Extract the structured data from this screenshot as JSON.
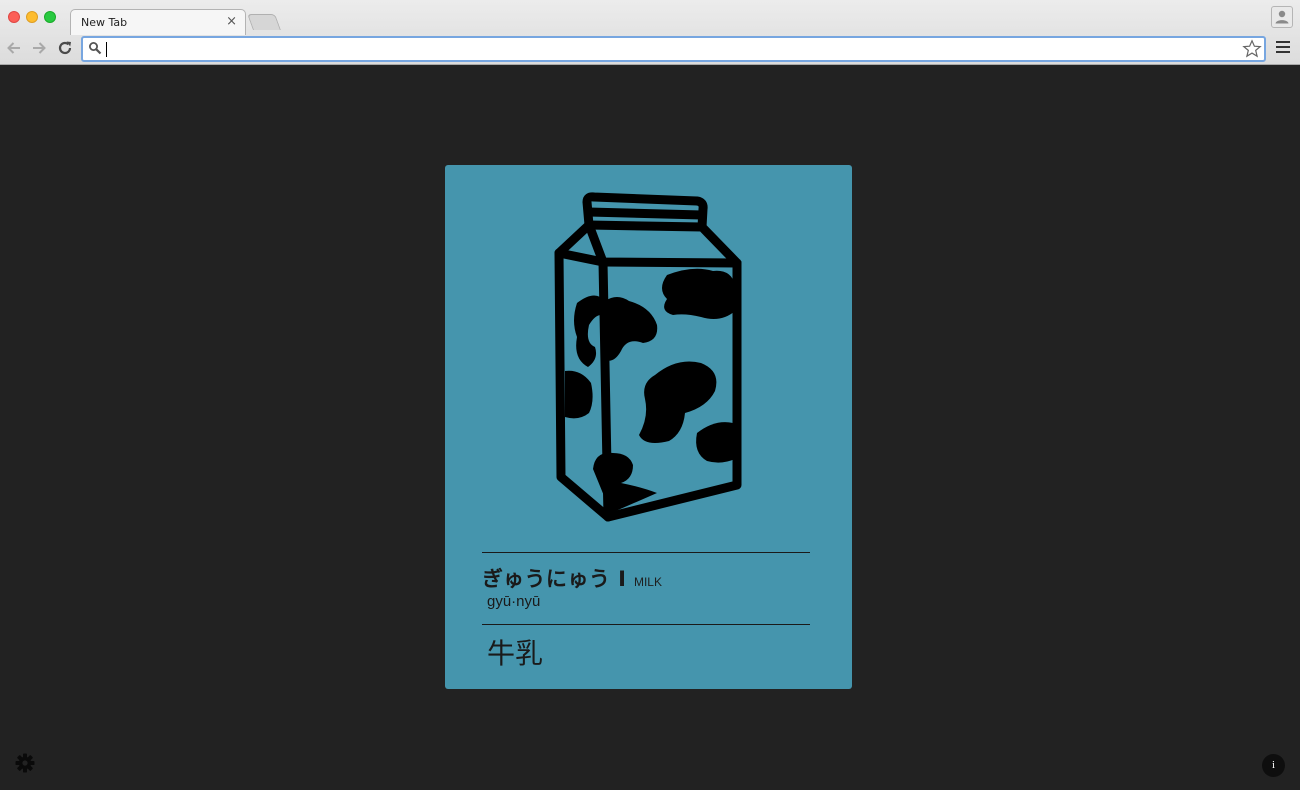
{
  "browser": {
    "tab": {
      "title": "New Tab",
      "close_glyph": "×"
    },
    "omnibox": {
      "value": "",
      "placeholder": ""
    },
    "icons": {
      "back": "back-arrow-icon",
      "forward": "forward-arrow-icon",
      "reload": "reload-icon",
      "search": "search-icon",
      "bookmark": "star-icon",
      "menu": "hamburger-menu-icon",
      "profile": "person-icon"
    }
  },
  "card": {
    "background_color": "#4595ad",
    "illustration": "milk-carton-icon",
    "kana": "ぎゅうにゅう I",
    "english": "MILK",
    "romaji": "gyū·nyū",
    "kanji": "牛乳"
  },
  "controls": {
    "settings_icon": "gear-icon",
    "info_label": "i"
  },
  "colors": {
    "page_background": "#222222",
    "ink": "#1a1a1a"
  }
}
